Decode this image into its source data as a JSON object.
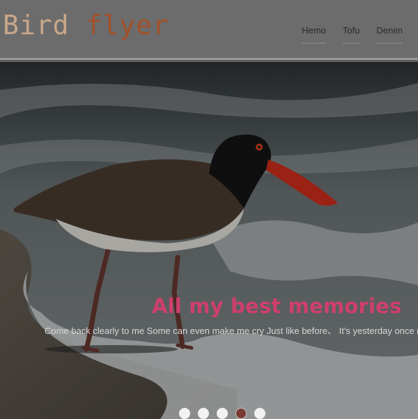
{
  "header": {
    "brand_word1": "Bird",
    "brand_word2": "flyer",
    "nav": [
      "Hemo",
      "Tofu",
      "Denim"
    ]
  },
  "hero": {
    "image_alt": "bird-on-beach",
    "headline": "All my best memories",
    "subline": "Come back clearly to me Some can even make me cry Just like before、 It's yesterday once more",
    "carousel": {
      "slide_count": 5,
      "active_index": 3
    }
  },
  "colors": {
    "brand_word1": "#c9a78a",
    "brand_word2": "#a3502a",
    "headline": "#cf3f6c",
    "active_dot": "#7b3a34"
  }
}
